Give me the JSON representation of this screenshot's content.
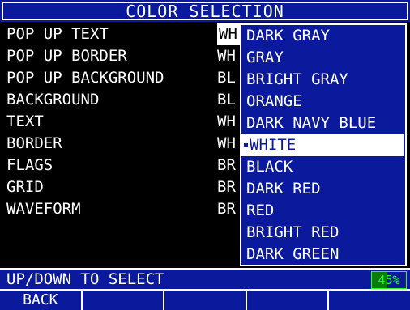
{
  "title": "COLOR SELECTION",
  "menu": [
    {
      "label": "POP UP TEXT",
      "value": "WH",
      "selected": true
    },
    {
      "label": "POP UP BORDER",
      "value": "WH",
      "selected": false
    },
    {
      "label": "POP UP BACKGROUND",
      "value": "BL",
      "selected": false
    },
    {
      "label": "BACKGROUND",
      "value": "BL",
      "selected": false
    },
    {
      "label": "TEXT",
      "value": "WH",
      "selected": false
    },
    {
      "label": "BORDER",
      "value": "WH",
      "selected": false
    },
    {
      "label": "FLAGS",
      "value": "BR",
      "selected": false
    },
    {
      "label": "GRID",
      "value": "BR",
      "selected": false
    },
    {
      "label": "WAVEFORM",
      "value": "BR",
      "selected": false
    }
  ],
  "dropdown": {
    "options": [
      "DARK GRAY",
      "GRAY",
      "BRIGHT GRAY",
      "ORANGE",
      "DARK NAVY BLUE",
      "WHITE",
      "BLACK",
      "DARK RED",
      "RED",
      "BRIGHT RED",
      "DARK GREEN"
    ],
    "highlighted_index": 5
  },
  "status": {
    "message": "UP/DOWN TO SELECT",
    "battery_percent": 45,
    "battery_label": "45%"
  },
  "softkeys": [
    "BACK",
    "",
    "",
    "",
    ""
  ],
  "colors": {
    "panel": "#0b1a9c",
    "battery": "#23ff23"
  }
}
